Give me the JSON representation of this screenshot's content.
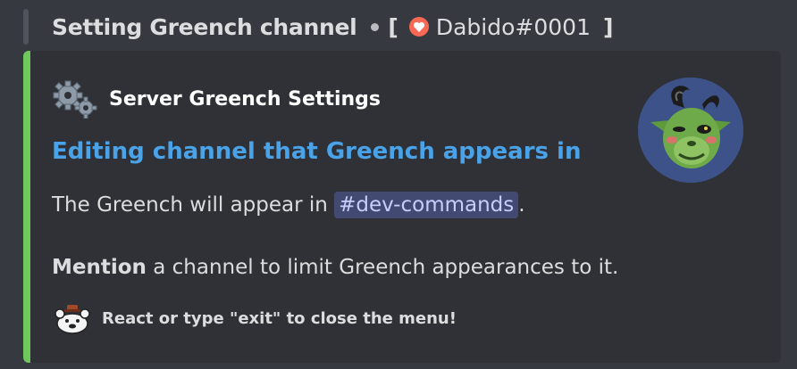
{
  "header": {
    "title": "Setting Greench channel",
    "open_bracket": "[",
    "username": "Dabido#0001",
    "close_bracket": "]"
  },
  "embed": {
    "accent_color": "#6ec85a",
    "author": {
      "name": "Server Greench Settings",
      "icon": "gears-icon"
    },
    "thumbnail": "greench-avatar",
    "title": "Editing channel that Greench appears in",
    "description_prefix": "The Greench will appear in ",
    "channel_mention": "#dev-commands",
    "description_suffix": ".",
    "mention_bold": "Mention",
    "mention_rest": " a channel to limit Greench appearances to it.",
    "footer": {
      "text": "React or type \"exit\" to close the menu!",
      "icon": "bear-emoji-icon"
    }
  }
}
